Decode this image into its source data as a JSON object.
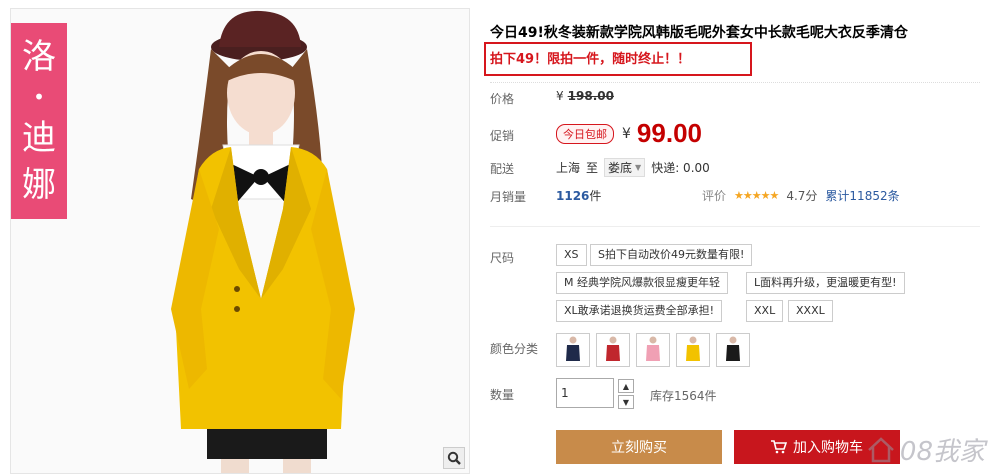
{
  "brand": {
    "chars": [
      "洛",
      "•",
      "迪",
      "娜"
    ]
  },
  "product": {
    "title": "今日49!秋冬装新款学院风韩版毛呢外套女中长款毛呢大衣反季清仓",
    "promo_text": "拍下49！限拍一件，随时终止！！"
  },
  "price": {
    "label": "价格",
    "currency": "¥",
    "original": "198.00"
  },
  "promotion": {
    "label": "促销",
    "badge": "今日包邮",
    "currency": "¥",
    "sale_price": "99.00"
  },
  "shipping": {
    "label": "配送",
    "from": "上海",
    "to_word": "至",
    "destination": "娄底",
    "express": "快递: 0.00"
  },
  "sales": {
    "label": "月销量",
    "count": "1126",
    "unit": "件"
  },
  "rating": {
    "label": "评价",
    "stars": "★★★★★",
    "score": "4.7分",
    "total": "累计11852条"
  },
  "size": {
    "label": "尺码",
    "options": [
      "XS",
      "S拍下自动改价49元数量有限!",
      "M 经典学院风爆款很显瘦更年轻",
      "L面料再升级，更温暖更有型!",
      "XL敢承诺退换货运费全部承担!",
      "XXL",
      "XXXL"
    ]
  },
  "color": {
    "label": "颜色分类"
  },
  "quantity": {
    "label": "数量",
    "value": "1",
    "stock": "库存1564件"
  },
  "buttons": {
    "buy_now": "立刻购买",
    "add_cart": "加入购物车"
  },
  "watermark": {
    "text": "08我家"
  },
  "colors": {
    "accent_red": "#c40000",
    "buy_button": "#c88b4a",
    "cart_button": "#c8161d",
    "brand_pink": "#e94b76",
    "coat_yellow": "#f2c200"
  }
}
